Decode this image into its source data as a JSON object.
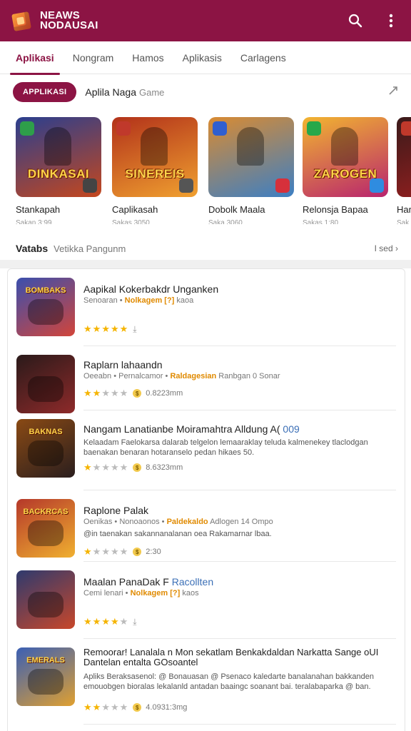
{
  "app": {
    "title": "NEAWS NODAUSAI",
    "brand_color": "#8c1444"
  },
  "appbar": {
    "icons": [
      "search-icon",
      "more-vert-icon"
    ]
  },
  "tabs": [
    {
      "label": "Aplikasi",
      "active": true
    },
    {
      "label": "Nongram",
      "active": false
    },
    {
      "label": "Hamos",
      "active": false
    },
    {
      "label": "Aplikasis",
      "active": false
    },
    {
      "label": "Carlagens",
      "active": false
    }
  ],
  "filter": {
    "chip": "APPLIKASI",
    "title": "Aplila Naga",
    "subtitle": "Game"
  },
  "carousel": [
    {
      "name": "Stankapah",
      "meta": "Sakan 3:99",
      "art": "DINKASAI",
      "bg": "#2a3f8f",
      "bg2": "#c4471e",
      "badge_l": "#2e9e4a",
      "badge_r": "#444"
    },
    {
      "name": "Caplikasah",
      "meta": "Sakas 3050",
      "art": "SINEREIS",
      "bg": "#b2321a",
      "bg2": "#f0a030",
      "badge_l": "#c0392b",
      "badge_r": "#555"
    },
    {
      "name": "Dobolk Maala",
      "meta": "Saka 3060",
      "art": "",
      "bg": "#d98b32",
      "bg2": "#3c7fc4",
      "badge_l": "#2f5fd0",
      "badge_r": "#d6303b"
    },
    {
      "name": "Relonsja Bapaa",
      "meta": "Sakas 1:80",
      "art": "ZAROGEN",
      "bg": "#f2b530",
      "bg2": "#b8246e",
      "badge_l": "#27a84a",
      "badge_r": "#2f8ce0"
    },
    {
      "name": "Har",
      "meta": "Sak",
      "art": "",
      "bg": "#3a1a1a",
      "bg2": "#a02020",
      "badge_l": "#c0392b",
      "badge_r": "#444"
    }
  ],
  "section": {
    "title": "Vatabs",
    "subtitle": "Vetikka Pangunm",
    "see_all": "I sed ›"
  },
  "list": [
    {
      "title": "Aapikal Kokerbakdr Unganken",
      "title_hl": "",
      "sub_pre": "Senoaran •",
      "sub_tag": "Nolkagem [?]",
      "sub_post": "kaoa",
      "desc": "",
      "stars": 5,
      "rating_text": "",
      "icon_label": "BOMBAKS",
      "icon_bg": "#3a4fae",
      "icon_bg2": "#d2453a"
    },
    {
      "title": "Raplarn lahaandn",
      "title_hl": "",
      "sub_pre": "Oeeabn • Pernalcamor •",
      "sub_tag": "Raldagesian",
      "sub_post": "Ranbgan 0 Sonar",
      "desc": "",
      "stars": 2,
      "rating_text": "0.8223mm",
      "icon_label": "",
      "icon_bg": "#2a1a1a",
      "icon_bg2": "#8e2a2a"
    },
    {
      "title": "Nangam Lanatianbe Moiramahtra Alldung A(",
      "title_hl": "009",
      "sub_pre": "",
      "sub_tag": "",
      "sub_post": "",
      "desc": "Kelaadam Faelokarsa dalarab telgelon lemaaraklay teluda kalmenekey tlaclodgan baenakan benaran hotaranselo pedan hikaes 50.",
      "stars": 1,
      "rating_text": "8.6323mm",
      "icon_label": "BAKNAS",
      "icon_bg": "#8a4a14",
      "icon_bg2": "#2a1e1e"
    },
    {
      "title": "Raplone Palak",
      "title_hl": "",
      "sub_pre": "Oenikas • Nonoaonos •",
      "sub_tag": "Paldekaldo",
      "sub_post": "Adlogen 14 Ompo",
      "desc": "@in taenakan sakannanalanan oea Rakamarnar lbaa.",
      "stars": 1,
      "rating_text": "2:30",
      "icon_label": "BACKRCAS",
      "icon_bg": "#b5382a",
      "icon_bg2": "#f0b030"
    },
    {
      "title": "Maalan PanaDak F",
      "title_hl": "Racollten",
      "sub_pre": "Cemi lenari •",
      "sub_tag": "Nolkagem [?]",
      "sub_post": "kaos",
      "desc": "",
      "stars": 4,
      "rating_text": "",
      "icon_label": "",
      "icon_bg": "#2e3a6e",
      "icon_bg2": "#c8472a"
    },
    {
      "title": "Remoorar! Lanalala n Mon sekatlam Benkakdaldan Narkatta Sange oUI Dantelan entalta GOsoantel",
      "title_hl": "",
      "sub_pre": "",
      "sub_tag": "",
      "sub_post": "",
      "desc": "Apliks Beraksasenol: @ Bonauasan @ Psenaco kaledarte banalanahan bakkanden emouobgen bioralas lekalanld antadan baaingc soanant bai. teralabaparka @ ban.",
      "stars": 2,
      "rating_text": "4.0931:3mg",
      "icon_label": "EMERALS",
      "icon_bg": "#3a5fb5",
      "icon_bg2": "#e0a030"
    }
  ]
}
